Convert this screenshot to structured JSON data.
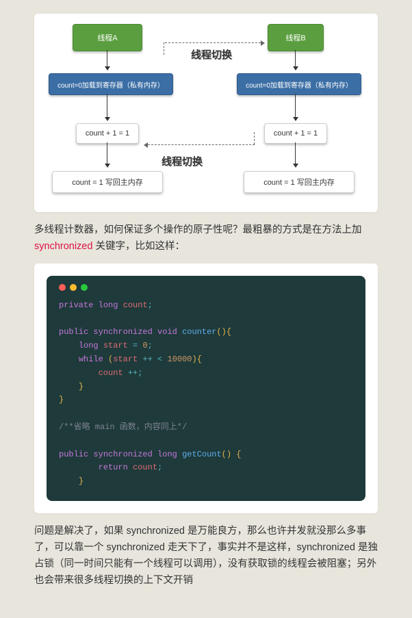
{
  "diagram": {
    "threadA": "线程A",
    "threadB": "线程B",
    "switch1": "线程切换",
    "loadA": "count=0加载到寄存器（私有内存）",
    "loadB": "count=0加载到寄存器（私有内存）",
    "incA": "count + 1 = 1",
    "incB": "count + 1 = 1",
    "switch2": "线程切换",
    "writeA": "count = 1 写回主内存",
    "writeB": "count = 1 写回主内存"
  },
  "para1_a": "多线程计数器，如何保证多个操作的原子性呢？最粗暴的方式是在方法上加 ",
  "para1_kw": "synchronized",
  "para1_b": " 关键字，比如这样：",
  "code": {
    "line1_kw1": "private",
    "line1_kw2": "long",
    "line1_name": "count",
    "line1_end": ";",
    "line3_kw1": "public",
    "line3_kw2": "synchronized",
    "line3_kw3": "void",
    "line3_fn": "counter",
    "line3_p": "()",
    "line3_b": "{",
    "line4_kw": "long",
    "line4_name": "start",
    "line4_eq": " = ",
    "line4_num": "0",
    "line4_end": ";",
    "line5_kw": "while",
    "line5_p1": " (",
    "line5_name": "start",
    "line5_op": " ++ < ",
    "line5_num": "10000",
    "line5_p2": ")",
    "line5_b": "{",
    "line6_name": "count",
    "line6_op": " ++",
    "line6_end": ";",
    "line7_b": "}",
    "line8_b": "}",
    "line10_cmt": "/**省略 main 函数，内容同上*/",
    "line12_kw1": "public",
    "line12_kw2": "synchronized",
    "line12_kw3": "long",
    "line12_fn": "getCount",
    "line12_p": "()",
    "line12_b": " {",
    "line13_kw": "return",
    "line13_name": "count",
    "line13_end": ";",
    "line14_b": "}"
  },
  "para2": "问题是解决了，如果 synchronized 是万能良方，那么也许并发就没那么多事了，可以靠一个 synchronized 走天下了，事实并不是这样，synchronized 是独占锁（同一时间只能有一个线程可以调用），没有获取锁的线程会被阻塞；另外也会带来很多线程切换的上下文开销"
}
